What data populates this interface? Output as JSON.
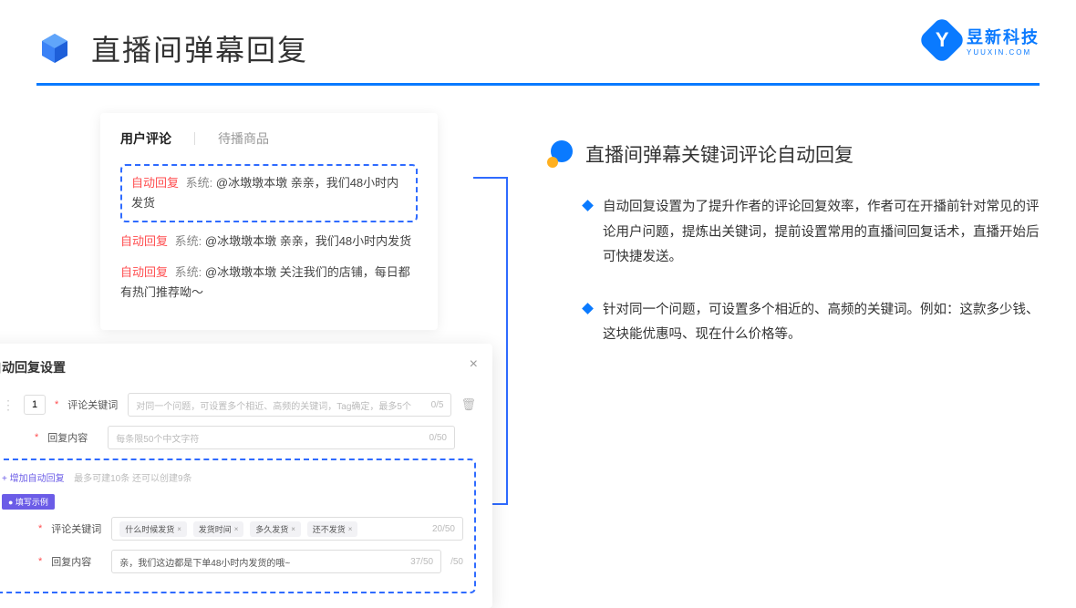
{
  "header": {
    "title": "直播间弹幕回复",
    "logo_cn": "昱新科技",
    "logo_en": "YUUXIN.COM",
    "logo_letter": "Y"
  },
  "card1": {
    "tab1": "用户评论",
    "tab2": "待播商品",
    "hl_prefix": "自动回复",
    "hl_sys": "系统:",
    "hl_text": "@冰墩墩本墩 亲亲，我们48小时内发货",
    "row2_text": "@冰墩墩本墩 亲亲，我们48小时内发货",
    "row3_text": "@冰墩墩本墩 关注我们的店铺，每日都有热门推荐呦～"
  },
  "modal": {
    "title": "自动回复设置",
    "num": "1",
    "label1": "评论关键词",
    "ph1": "对同一个问题，可设置多个相近、高频的关键词，Tag确定，最多5个",
    "count1": "0/5",
    "label2": "回复内容",
    "ph2": "每条限50个中文字符",
    "count2": "0/50",
    "add_link": "+ 增加自动回复",
    "quota": "最多可建10条 还可以创建9条",
    "badge": "● 填写示例",
    "ex_label1": "评论关键词",
    "tag1": "什么时候发货",
    "tag2": "发货时间",
    "tag3": "多久发货",
    "tag4": "还不发货",
    "ex_count1": "20/50",
    "ex_label2": "回复内容",
    "ex_text": "亲，我们这边都是下单48小时内发货的哦~",
    "ex_count2": "37/50",
    "ex_count3": "/50"
  },
  "right": {
    "section_title": "直播间弹幕关键词评论自动回复",
    "bullet1": "自动回复设置为了提升作者的评论回复效率，作者可在开播前针对常见的评论用户问题，提炼出关键词，提前设置常用的直播间回复话术，直播开始后可快捷发送。",
    "bullet2": "针对同一个问题，可设置多个相近的、高频的关键词。例如：这款多少钱、这块能优惠吗、现在什么价格等。"
  }
}
